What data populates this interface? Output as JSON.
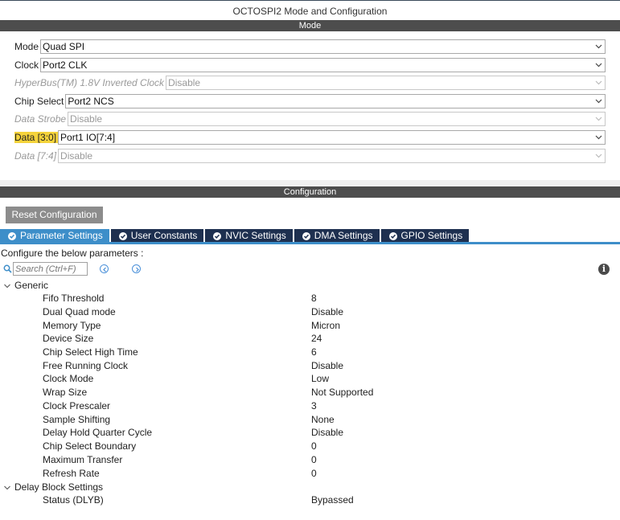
{
  "window": {
    "title": "OCTOSPI2 Mode and Configuration"
  },
  "mode_section": {
    "header": "Mode",
    "fields": [
      {
        "label": "Mode",
        "value": "Quad SPI",
        "enabled": true,
        "highlight": false
      },
      {
        "label": "Clock",
        "value": "Port2 CLK",
        "enabled": true,
        "highlight": false
      },
      {
        "label": "HyperBus(TM) 1.8V Inverted Clock",
        "value": "Disable",
        "enabled": false,
        "highlight": false
      },
      {
        "label": "Chip Select",
        "value": "Port2 NCS",
        "enabled": true,
        "highlight": false
      },
      {
        "label": "Data Strobe",
        "value": "Disable",
        "enabled": false,
        "highlight": false
      },
      {
        "label": "Data [3:0]",
        "value": "Port1 IO[7:4]",
        "enabled": true,
        "highlight": true
      },
      {
        "label": "Data [7:4]",
        "value": "Disable",
        "enabled": false,
        "highlight": false
      }
    ]
  },
  "config_section": {
    "header": "Configuration",
    "reset_button": "Reset Configuration",
    "tabs": [
      {
        "label": "Parameter Settings",
        "active": true
      },
      {
        "label": "User Constants",
        "active": false
      },
      {
        "label": "NVIC Settings",
        "active": false
      },
      {
        "label": "DMA Settings",
        "active": false
      },
      {
        "label": "GPIO Settings",
        "active": false
      }
    ],
    "instructions": "Configure the below parameters :",
    "search": {
      "placeholder": "Search (Ctrl+F)",
      "value": ""
    },
    "groups": [
      {
        "name": "Generic",
        "params": [
          {
            "name": "Fifo Threshold",
            "value": "8"
          },
          {
            "name": "Dual Quad mode",
            "value": "Disable"
          },
          {
            "name": "Memory Type",
            "value": "Micron"
          },
          {
            "name": "Device Size",
            "value": "24"
          },
          {
            "name": "Chip Select High Time",
            "value": "6"
          },
          {
            "name": "Free Running Clock",
            "value": "Disable"
          },
          {
            "name": "Clock Mode",
            "value": "Low"
          },
          {
            "name": "Wrap Size",
            "value": "Not Supported"
          },
          {
            "name": "Clock Prescaler",
            "value": "3"
          },
          {
            "name": "Sample Shifting",
            "value": "None"
          },
          {
            "name": "Delay Hold Quarter Cycle",
            "value": "Disable"
          },
          {
            "name": "Chip Select Boundary",
            "value": "0"
          },
          {
            "name": "Maximum Transfer",
            "value": "0"
          },
          {
            "name": "Refresh Rate",
            "value": "0"
          }
        ]
      },
      {
        "name": "Delay Block Settings",
        "params": [
          {
            "name": "Status (DLYB)",
            "value": "Bypassed"
          }
        ]
      }
    ]
  },
  "colors": {
    "section_bar": "#4d4d4d",
    "tab_inactive": "#1e3050",
    "tab_active": "#3d8ec9",
    "highlight": "#f5d33b"
  }
}
